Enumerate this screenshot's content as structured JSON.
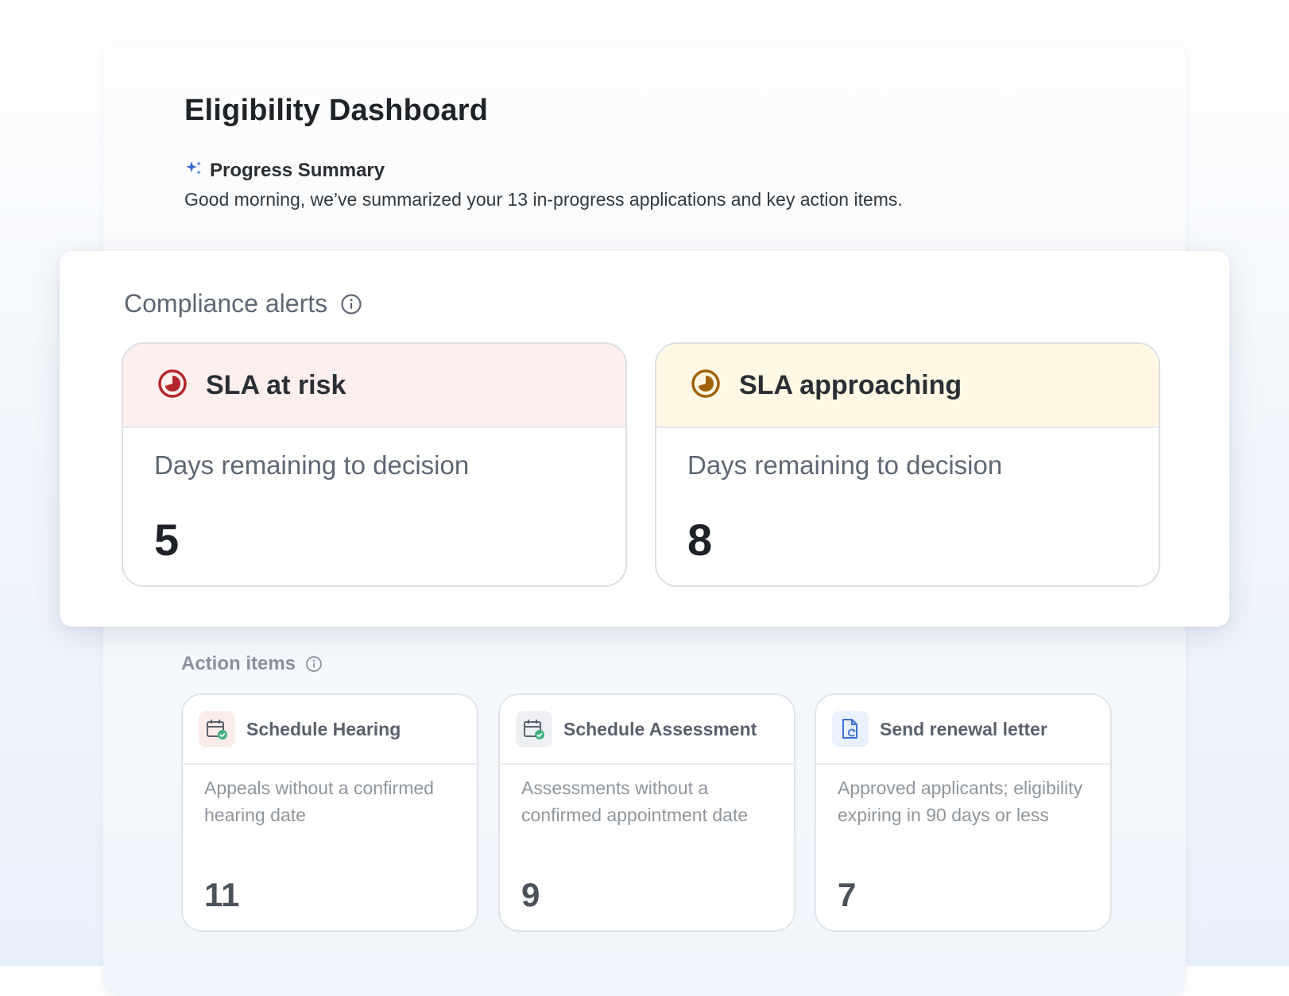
{
  "page": {
    "title": "Eligibility Dashboard"
  },
  "summary": {
    "heading": "Progress Summary",
    "text": "Good morning, we’ve summarized your 13 in-progress applications and key action items.",
    "icon": "sparkle-icon"
  },
  "compliance": {
    "heading": "Compliance alerts",
    "cards": [
      {
        "label": "SLA at risk",
        "description": "Days remaining to decision",
        "value": "5",
        "icon": "timer-icon",
        "color": "#b3262a"
      },
      {
        "label": "SLA approaching",
        "description": "Days remaining to decision",
        "value": "8",
        "icon": "timer-icon",
        "color": "#a16207"
      }
    ]
  },
  "action_items": {
    "heading": "Action items",
    "cards": [
      {
        "label": "Schedule Hearing",
        "description": "Appeals without a confirmed hearing date",
        "value": "11",
        "icon": "calendar-check-icon"
      },
      {
        "label": "Schedule Assessment",
        "description": "Assessments without a confirmed appointment date",
        "value": "9",
        "icon": "calendar-check-icon"
      },
      {
        "label": "Send renewal letter",
        "description": "Approved applicants; eligibility expiring in 90 days or less",
        "value": "7",
        "icon": "document-refresh-icon"
      }
    ]
  }
}
